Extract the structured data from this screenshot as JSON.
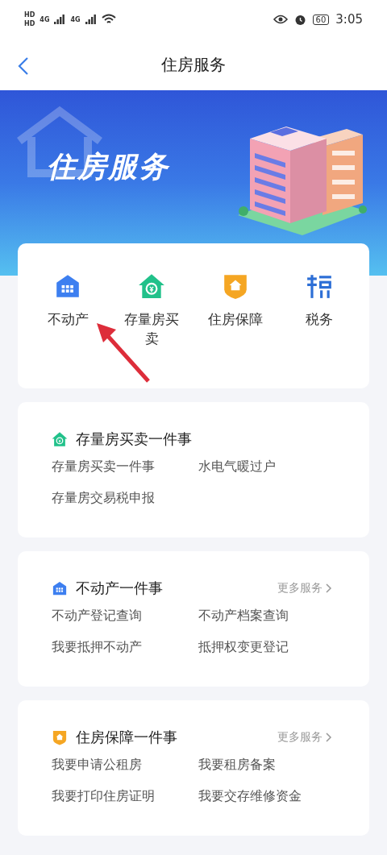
{
  "status_bar": {
    "sim_labels": [
      "HD",
      "HD"
    ],
    "networks": [
      "4G",
      "4G"
    ],
    "battery": "60",
    "time": "3:05"
  },
  "header": {
    "title": "住房服务"
  },
  "banner": {
    "title": "住房服务"
  },
  "quick_links": [
    {
      "label": "不动产",
      "kind": "building"
    },
    {
      "label": "存量房买卖",
      "kind": "house"
    },
    {
      "label": "住房保障",
      "kind": "shield"
    },
    {
      "label": "税务",
      "kind": "tax"
    }
  ],
  "sections": [
    {
      "title": "存量房买卖一件事",
      "kind": "house",
      "items": [
        "存量房买卖一件事",
        "水电气暖过户",
        "存量房交易税申报"
      ]
    },
    {
      "title": "不动产一件事",
      "kind": "building",
      "more": "更多服务",
      "items": [
        "不动产登记查询",
        "不动产档案查询",
        "我要抵押不动产",
        "抵押权变更登记"
      ]
    },
    {
      "title": "住房保障一件事",
      "kind": "shield",
      "more": "更多服务",
      "items": [
        "我要申请公租房",
        "我要租房备案",
        "我要打印住房证明",
        "我要交存维修资金"
      ]
    }
  ]
}
